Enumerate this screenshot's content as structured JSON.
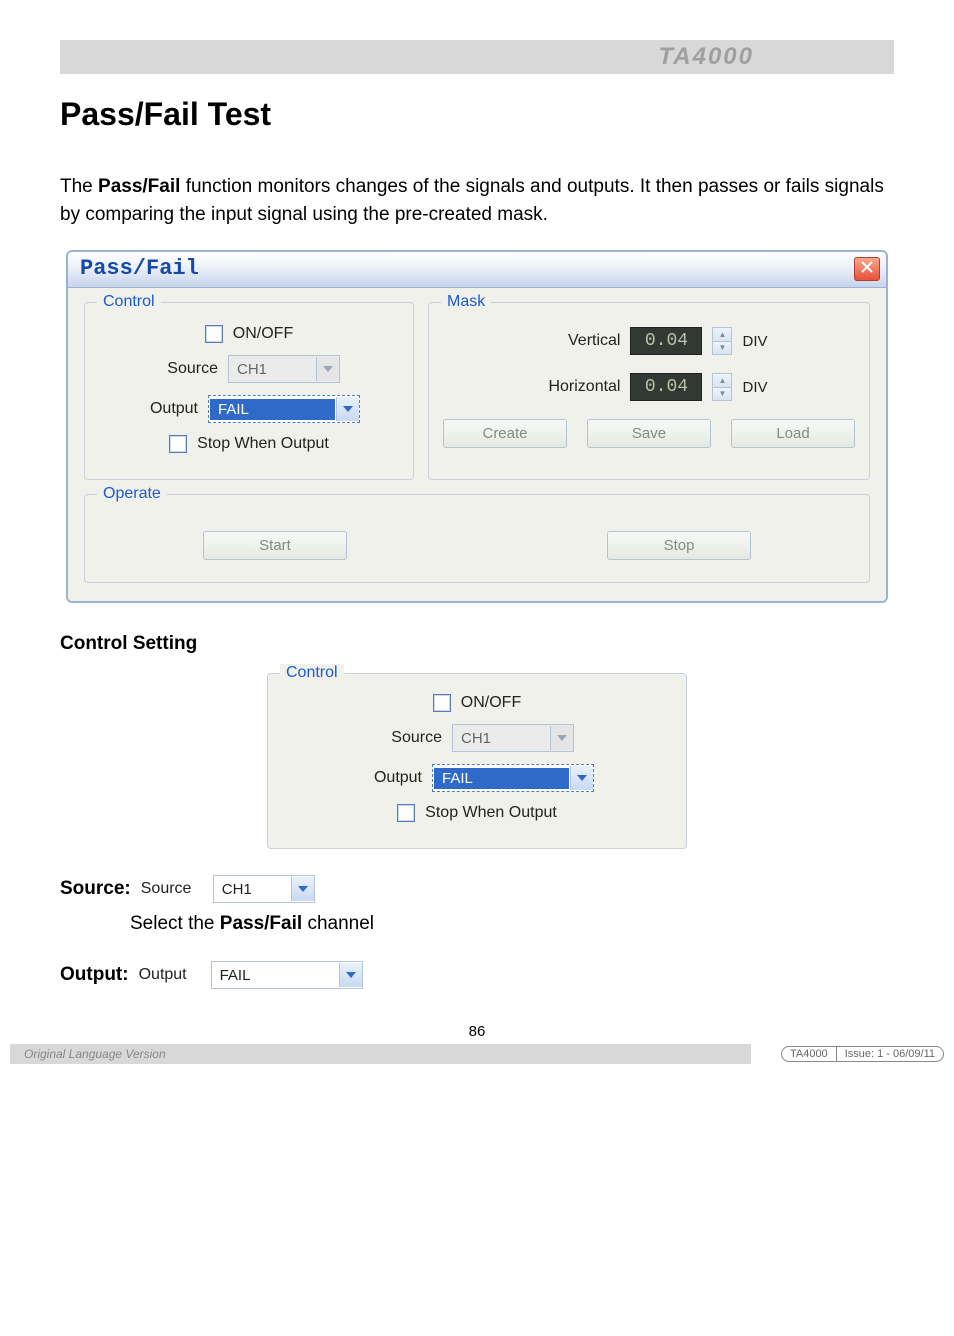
{
  "header": {
    "product": "TA4000"
  },
  "title": "Pass/Fail Test",
  "intro_pre": "The ",
  "intro_bold": "Pass/Fail",
  "intro_post": " function monitors changes of the signals and outputs. It then passes or fails signals by comparing the input signal using the pre-created mask.",
  "dialog": {
    "title": "Pass/Fail",
    "control": {
      "legend": "Control",
      "onoff": "ON/OFF",
      "source_label": "Source",
      "source_value": "CH1",
      "output_label": "Output",
      "output_value": "FAIL",
      "stop_when": "Stop When Output"
    },
    "mask": {
      "legend": "Mask",
      "vertical_label": "Vertical",
      "vertical_value": "0.04",
      "horizontal_label": "Horizontal",
      "horizontal_value": "0.04",
      "unit": "DIV",
      "create": "Create",
      "save": "Save",
      "load": "Load"
    },
    "operate": {
      "legend": "Operate",
      "start": "Start",
      "stop": "Stop"
    }
  },
  "sections": {
    "control_setting": "Control Setting",
    "source_heading": "Source",
    "source_desc_pre": "Select the ",
    "source_desc_bold": "Pass/Fail",
    "source_desc_post": " channel",
    "output_heading": "Output",
    "source_field_label": "Source",
    "source_field_value": "CH1",
    "output_field_label": "Output",
    "output_field_value": "FAIL"
  },
  "footer": {
    "page": "86",
    "left": "Original Language Version",
    "right1": "TA4000",
    "right2": "Issue: 1 - 06/09/11"
  }
}
